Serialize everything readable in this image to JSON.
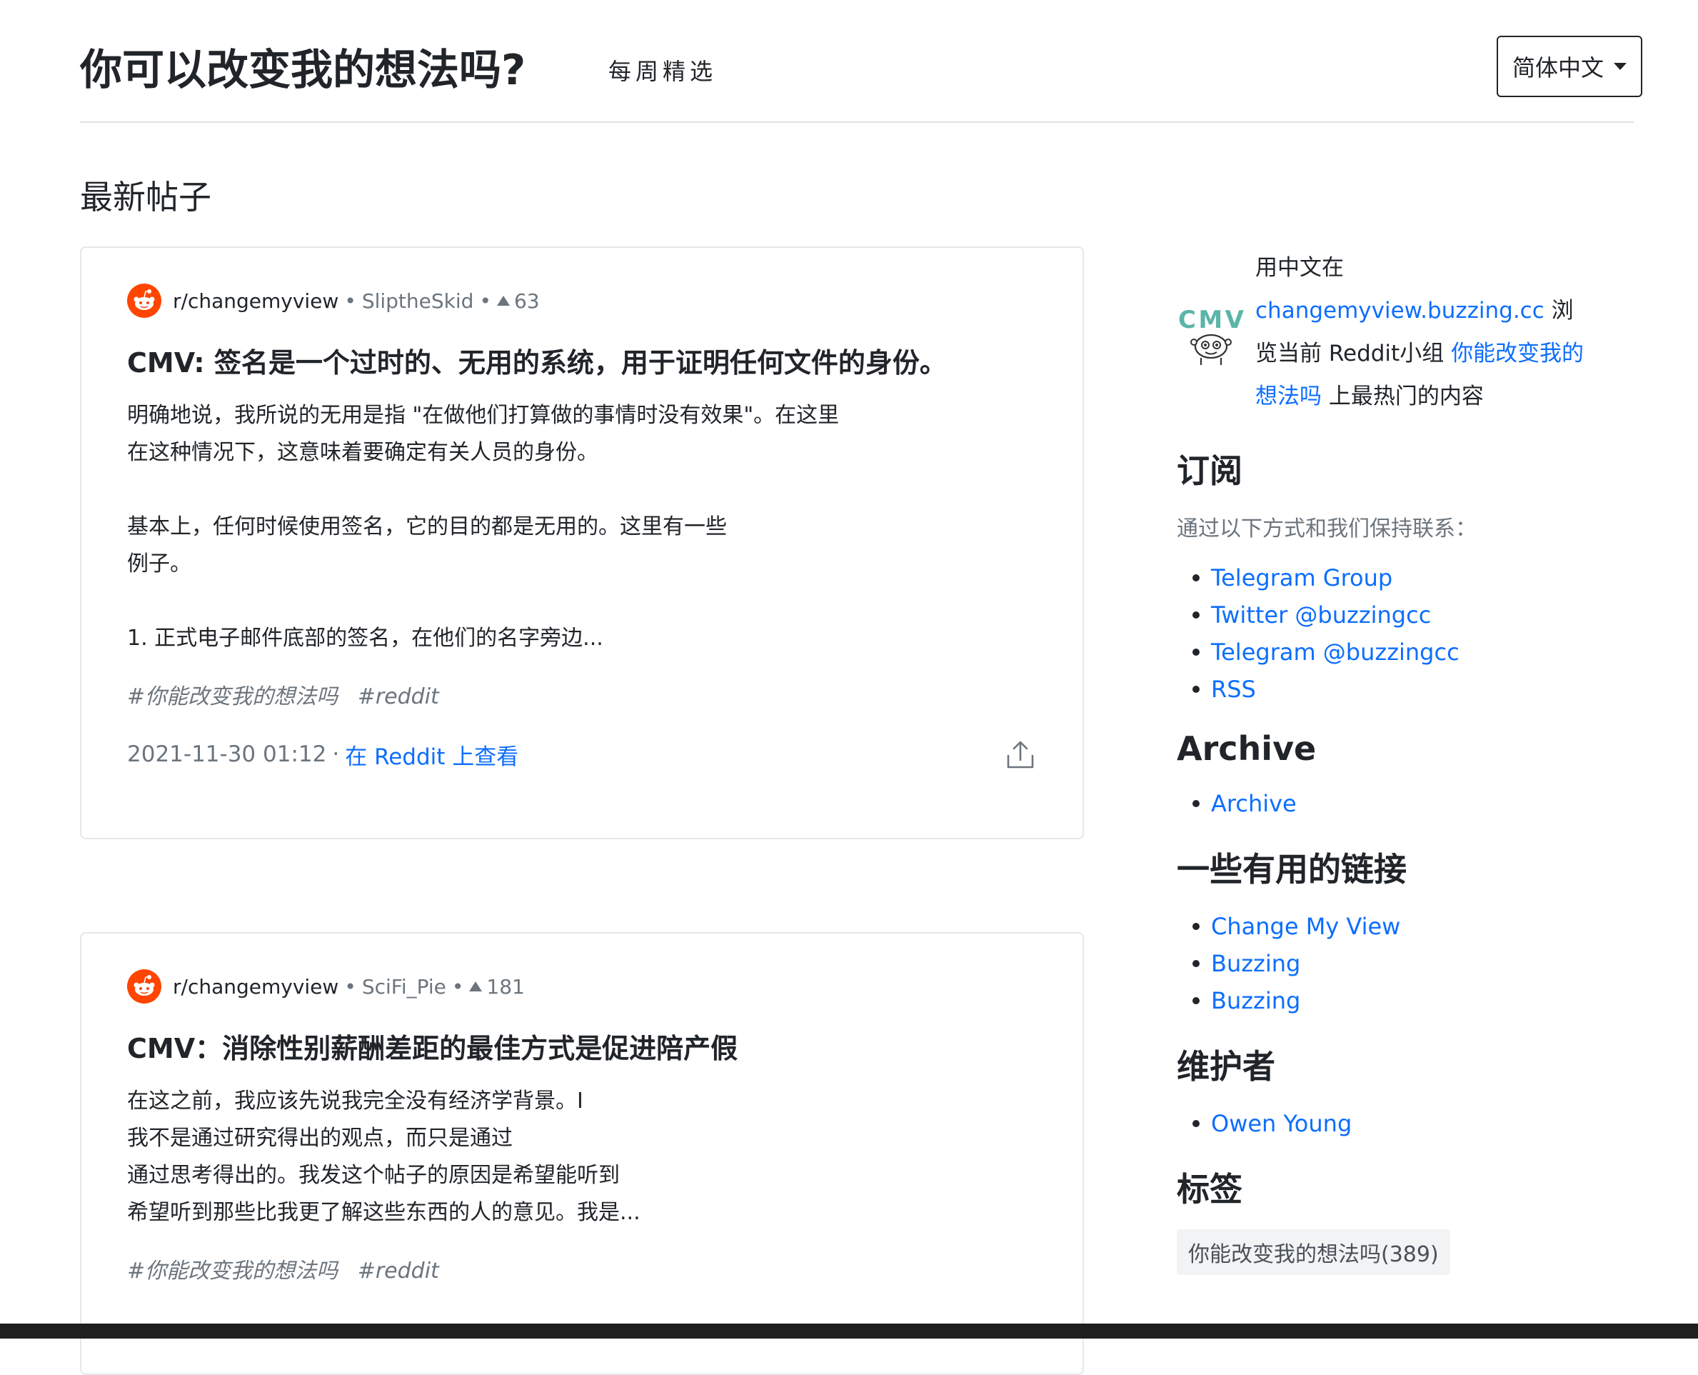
{
  "header": {
    "site_title": "你可以改变我的想法吗?",
    "weekly_label": "每周精选",
    "language_label": "简体中文"
  },
  "main": {
    "section_title": "最新帖子",
    "posts": [
      {
        "subreddit": "r/changemyview",
        "author": "SliptheSkid",
        "score": "63",
        "title": "CMV: 签名是一个过时的、无用的系统，用于证明任何文件的身份。",
        "body": "明确地说，我所说的无用是指 \"在做他们打算做的事情时没有效果\"。在这里\n在这种情况下，这意味着要确定有关人员的身份。\n\n基本上，任何时候使用签名，它的目的都是无用的。这里有一些\n例子。\n\n1. 正式电子邮件底部的签名，在他们的名字旁边...",
        "tags": [
          "#你能改变我的想法吗",
          "#reddit"
        ],
        "date": "2021-11-30 01:12",
        "view_link": "在 Reddit 上查看"
      },
      {
        "subreddit": "r/changemyview",
        "author": "SciFi_Pie",
        "score": "181",
        "title": "CMV：消除性别薪酬差距的最佳方式是促进陪产假",
        "body": "在这之前，我应该先说我完全没有经济学背景。I\n我不是通过研究得出的观点，而只是通过\n通过思考得出的。我发这个帖子的原因是希望能听到\n希望听到那些比我更了解这些东西的人的意见。我是...",
        "tags": [
          "#你能改变我的想法吗",
          "#reddit"
        ]
      }
    ]
  },
  "sidebar": {
    "intro": {
      "prefix": "用中文在",
      "site_link": "changemyview.buzzing.cc",
      "middle": " 浏览当前 Reddit小组 ",
      "group_link": "你能改变我的想法吗",
      "suffix": " 上最热门的内容"
    },
    "subscribe": {
      "title": "订阅",
      "subtitle": "通过以下方式和我们保持联系：",
      "links": [
        "Telegram Group",
        "Twitter @buzzingcc",
        "Telegram @buzzingcc",
        "RSS"
      ]
    },
    "archive": {
      "title": "Archive",
      "links": [
        "Archive"
      ]
    },
    "useful": {
      "title": "一些有用的链接",
      "links": [
        "Change My View",
        "Buzzing",
        "Buzzing"
      ]
    },
    "maintainers": {
      "title": "维护者",
      "links": [
        "Owen Young"
      ]
    },
    "tags": {
      "title": "标签",
      "items": [
        "你能改变我的想法吗(389)"
      ]
    }
  },
  "colors": {
    "link": "#0d6efd",
    "muted": "#6c757d",
    "reddit_orange": "#ff4500",
    "cmv_teal": "#5bb5a8"
  },
  "icons": {
    "reddit": "reddit-icon",
    "upvote": "upvote-icon",
    "share": "share-icon",
    "dropdown": "chevron-down-icon",
    "logo": "cmv-logo"
  }
}
